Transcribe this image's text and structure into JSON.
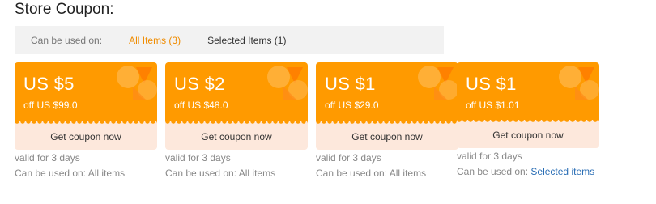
{
  "title": "Store Coupon:",
  "filter": {
    "label": "Can be used on:",
    "options": [
      "All Items (3)",
      "Selected Items (1)"
    ]
  },
  "coupons": [
    {
      "amount": "US $5",
      "condition": "off US $99.0",
      "button": "Get coupon now",
      "valid": "valid for 3 days",
      "usable_prefix": "Can be used on: ",
      "usable_value": "All items"
    },
    {
      "amount": "US $2",
      "condition": "off US $48.0",
      "button": "Get coupon now",
      "valid": "valid for 3 days",
      "usable_prefix": "Can be used on: ",
      "usable_value": "All items"
    },
    {
      "amount": "US $1",
      "condition": "off US $29.0",
      "button": "Get coupon now",
      "valid": "valid for 3 days",
      "usable_prefix": "Can be used on: ",
      "usable_value": "All items"
    },
    {
      "amount": "US $1",
      "condition": "off US $1.01",
      "button": "Get coupon now",
      "valid": "valid for 3 days",
      "usable_prefix": "Can be used on: ",
      "usable_value": "Selected items"
    }
  ],
  "colors": {
    "coupon_bg": "#ff9a00",
    "button_bg": "#fde8dc",
    "active_filter": "#f08c00",
    "link": "#2a6eb5"
  }
}
